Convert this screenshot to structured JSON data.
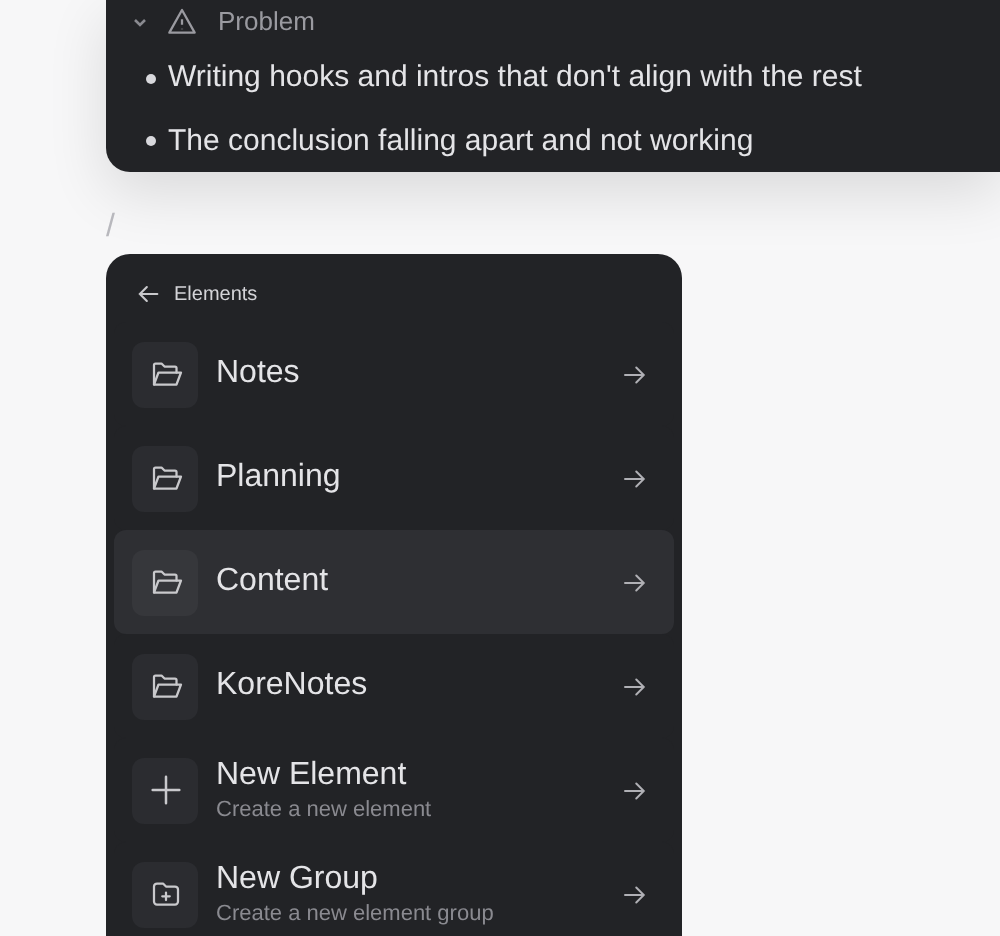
{
  "problem_block": {
    "expanded": true,
    "title": "Problem",
    "bullets": [
      "Writing hooks and intros that don't align with the rest",
      "The conclusion falling apart and not working"
    ]
  },
  "slash_input": {
    "value": "/"
  },
  "elements_menu": {
    "header": "Elements",
    "items": [
      {
        "kind": "folder",
        "label": "Notes",
        "selected": false
      },
      {
        "kind": "folder",
        "label": "Planning",
        "selected": false
      },
      {
        "kind": "folder",
        "label": "Content",
        "selected": true
      },
      {
        "kind": "folder",
        "label": "KoreNotes",
        "selected": false
      },
      {
        "kind": "plus",
        "label": "New Element",
        "description": "Create a new element",
        "selected": false
      },
      {
        "kind": "folder-plus",
        "label": "New Group",
        "description": "Create a new element group",
        "selected": false
      }
    ]
  }
}
